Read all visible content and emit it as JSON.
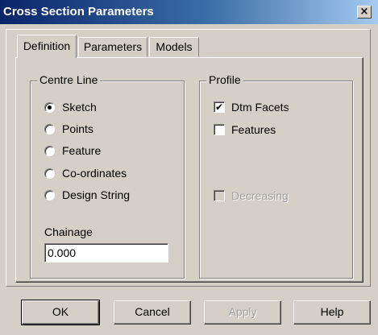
{
  "window": {
    "title": "Cross Section Parameters",
    "close_glyph": "×"
  },
  "tabs": [
    {
      "label": "Definition",
      "active": true
    },
    {
      "label": "Parameters",
      "active": false
    },
    {
      "label": "Models",
      "active": false
    }
  ],
  "centre_line": {
    "legend": "Centre Line",
    "options": [
      {
        "label": "Sketch",
        "selected": true
      },
      {
        "label": "Points",
        "selected": false
      },
      {
        "label": "Feature",
        "selected": false
      },
      {
        "label": "Co-ordinates",
        "selected": false
      },
      {
        "label": "Design String",
        "selected": false
      }
    ],
    "chainage_label": "Chainage",
    "chainage_value": "0.000"
  },
  "profile": {
    "legend": "Profile",
    "dtm_facets": {
      "label": "Dtm Facets",
      "checked": true
    },
    "features": {
      "label": "Features",
      "checked": false
    },
    "decreasing": {
      "label": "Decreasing",
      "checked": false,
      "enabled": false
    }
  },
  "buttons": {
    "ok": "OK",
    "cancel": "Cancel",
    "apply": "Apply",
    "help": "Help"
  },
  "icons": {
    "close": "close-icon",
    "check": "checkmark-icon",
    "radio_dot": "radio-dot-icon"
  }
}
